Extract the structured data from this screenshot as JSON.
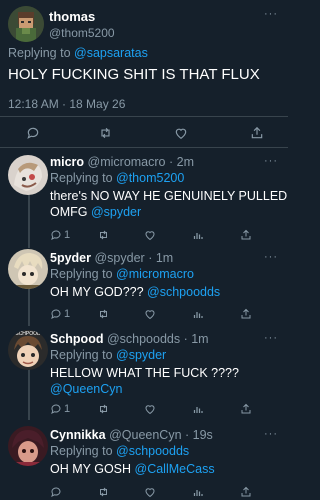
{
  "main_tweet": {
    "display_name": "thomas",
    "handle": "@thom5200",
    "replying_prefix": "Replying to ",
    "replying_to": "@sapsaratas",
    "text": "HOLY FUCKING SHIT IS THAT FLUX",
    "timestamp": "12:18 AM · 18 May 26"
  },
  "replies": [
    {
      "display_name": "micro",
      "handle": "@micromacro",
      "time": "· 2m",
      "replying_prefix": "Replying to ",
      "replying_to": "@thom5200",
      "text_line1": "there's NO WAY HE GENUINELY PULLED",
      "text_line2_plain": "OMFG ",
      "text_line2_mention": "@spyder",
      "reply_count": "1"
    },
    {
      "display_name": "5pyder",
      "handle": "@spyder",
      "time": "· 1m",
      "replying_prefix": "Replying to ",
      "replying_to": "@micromacro",
      "text_plain": "OH MY GOD??? ",
      "text_mention": "@schpoodds",
      "reply_count": "1"
    },
    {
      "display_name": "Schpood",
      "handle": "@schpoodds",
      "time": "· 1m",
      "replying_prefix": "Replying to ",
      "replying_to": "@spyder",
      "text_line1": "HELLOW WHAT THE FUCK ????",
      "text_line2_mention": "@QueenCyn",
      "reply_count": "1",
      "avatar_text": "SCHPOOD"
    },
    {
      "display_name": "Cynnikka",
      "handle": "@QueenCyn",
      "time": "· 19s",
      "replying_prefix": "Replying to ",
      "replying_to": "@schpoodds",
      "text_plain": "OH MY GOSH ",
      "text_mention": "@CallMeCass"
    }
  ],
  "colors": {
    "background": "#15202b",
    "text": "#ffffff",
    "muted": "#8899a6",
    "link": "#1da1f2",
    "divider": "#38444d"
  }
}
